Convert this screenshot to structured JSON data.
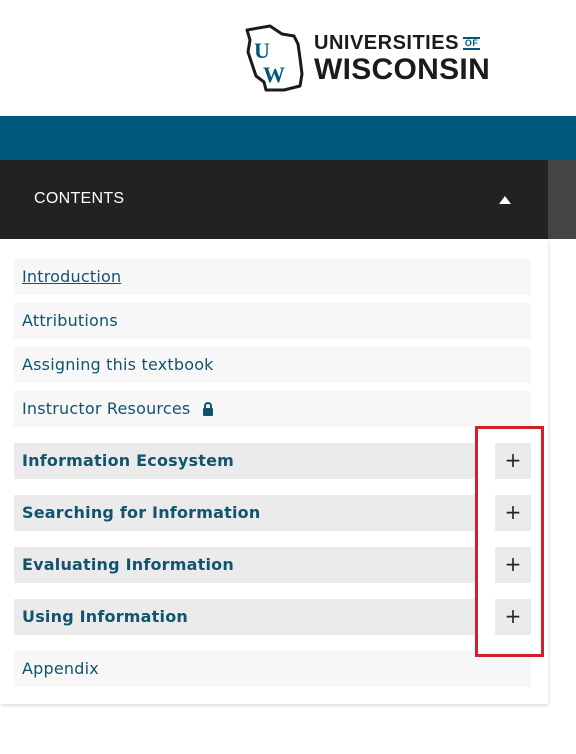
{
  "header": {
    "logo": {
      "letters": "UW",
      "line1": "UNIVERSITIES",
      "of": "OF",
      "line2": "WISCONSIN"
    }
  },
  "toc": {
    "heading": "CONTENTS",
    "toggle_icon": "triangle-up-icon",
    "items": [
      {
        "label": "Introduction",
        "type": "page",
        "current": true
      },
      {
        "label": "Attributions",
        "type": "page"
      },
      {
        "label": "Assigning this textbook",
        "type": "page"
      },
      {
        "label": "Instructor Resources",
        "type": "page",
        "icon": "lock-icon"
      },
      {
        "label": "Information Ecosystem",
        "type": "chapter",
        "action": "+"
      },
      {
        "label": "Searching for Information",
        "type": "chapter",
        "action": "+"
      },
      {
        "label": "Evaluating Information",
        "type": "chapter",
        "action": "+"
      },
      {
        "label": "Using Information",
        "type": "chapter",
        "action": "+"
      },
      {
        "label": "Appendix",
        "type": "page"
      }
    ]
  },
  "colors": {
    "brand_blue": "#00587a",
    "link": "#105470",
    "dark_bar": "#222222",
    "highlight": "#d0202a"
  }
}
